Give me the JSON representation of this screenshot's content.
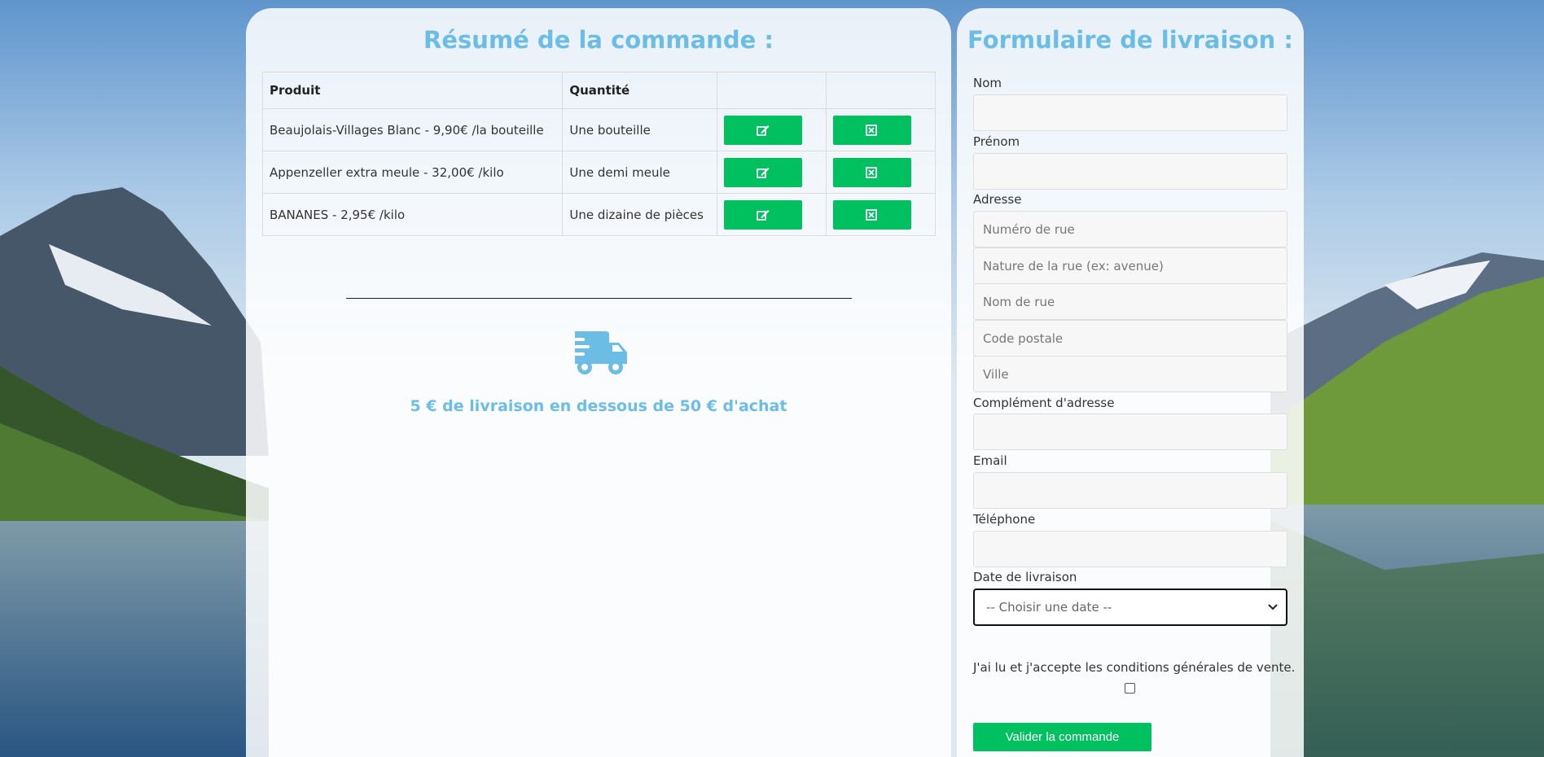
{
  "summary": {
    "title": "Résumé de la commande :",
    "columns": [
      "Produit",
      "Quantité",
      "",
      ""
    ],
    "rows": [
      {
        "product": "Beaujolais-Villages Blanc - 9,90€ /la bouteille",
        "quantity": "Une bouteille"
      },
      {
        "product": "Appenzeller extra meule - 32,00€ /kilo",
        "quantity": "Une demi meule"
      },
      {
        "product": "BANANES - 2,95€ /kilo",
        "quantity": "Une dizaine de pièces"
      }
    ],
    "edit_icon": "edit-icon",
    "delete_icon": "delete-icon",
    "delivery_icon": "truck-icon",
    "delivery_note": "5 € de livraison en dessous de 50 € d'achat"
  },
  "form": {
    "title": "Formulaire de livraison :",
    "nom_label": "Nom",
    "prenom_label": "Prénom",
    "adresse_label": "Adresse",
    "numero_placeholder": "Numéro de rue",
    "nature_placeholder": "Nature de la rue (ex: avenue)",
    "nom_rue_placeholder": "Nom de rue",
    "code_postal_placeholder": "Code postale",
    "ville_placeholder": "Ville",
    "complement_label": "Complément d'adresse",
    "email_label": "Email",
    "telephone_label": "Téléphone",
    "date_label": "Date de livraison",
    "date_selected": "-- Choisir une date --",
    "cgv_text": "J'ai lu et j'accepte les conditions générales de vente.",
    "submit_label": "Valider la commande"
  },
  "colors": {
    "accent": "#6cbde6",
    "button": "#00c060"
  }
}
